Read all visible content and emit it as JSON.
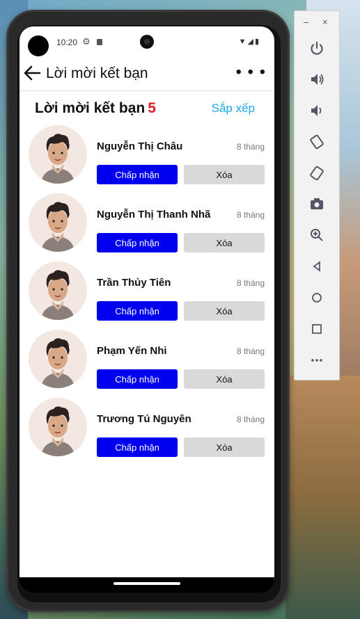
{
  "status_bar": {
    "time": "10:20"
  },
  "app_bar": {
    "title": "Lời mời kết bạn",
    "more": "• • •"
  },
  "header": {
    "title": "Lời mời kết bạn",
    "count": "5",
    "sort_label": "Sắp xếp"
  },
  "requests": [
    {
      "name": "Nguyễn Thị Châu",
      "time": "8 tháng",
      "accept": "Chấp nhận",
      "delete": "Xóa"
    },
    {
      "name": "Nguyễn Thị Thanh Nhã",
      "time": "8 tháng",
      "accept": "Chấp nhận",
      "delete": "Xóa"
    },
    {
      "name": "Trần Thủy Tiên",
      "time": "8 tháng",
      "accept": "Chấp nhận",
      "delete": "Xóa"
    },
    {
      "name": "Phạm Yến Nhi",
      "time": "8 tháng",
      "accept": "Chấp nhận",
      "delete": "Xóa"
    },
    {
      "name": "Trương Tú Nguyên",
      "time": "8 tháng",
      "accept": "Chấp nhận",
      "delete": "Xóa"
    }
  ],
  "emulator_toolbar": {
    "minimize": "–",
    "close": "×",
    "buttons": [
      "power-icon",
      "volume-up-icon",
      "volume-down-icon",
      "rotate-left-icon",
      "rotate-right-icon",
      "camera-icon",
      "zoom-icon",
      "back-icon",
      "home-icon",
      "overview-icon",
      "more-icon"
    ]
  },
  "colors": {
    "accept": "#0000ee",
    "delete": "#d9d9d9",
    "count": "#e41e1e",
    "sort": "#1fa9e8"
  }
}
